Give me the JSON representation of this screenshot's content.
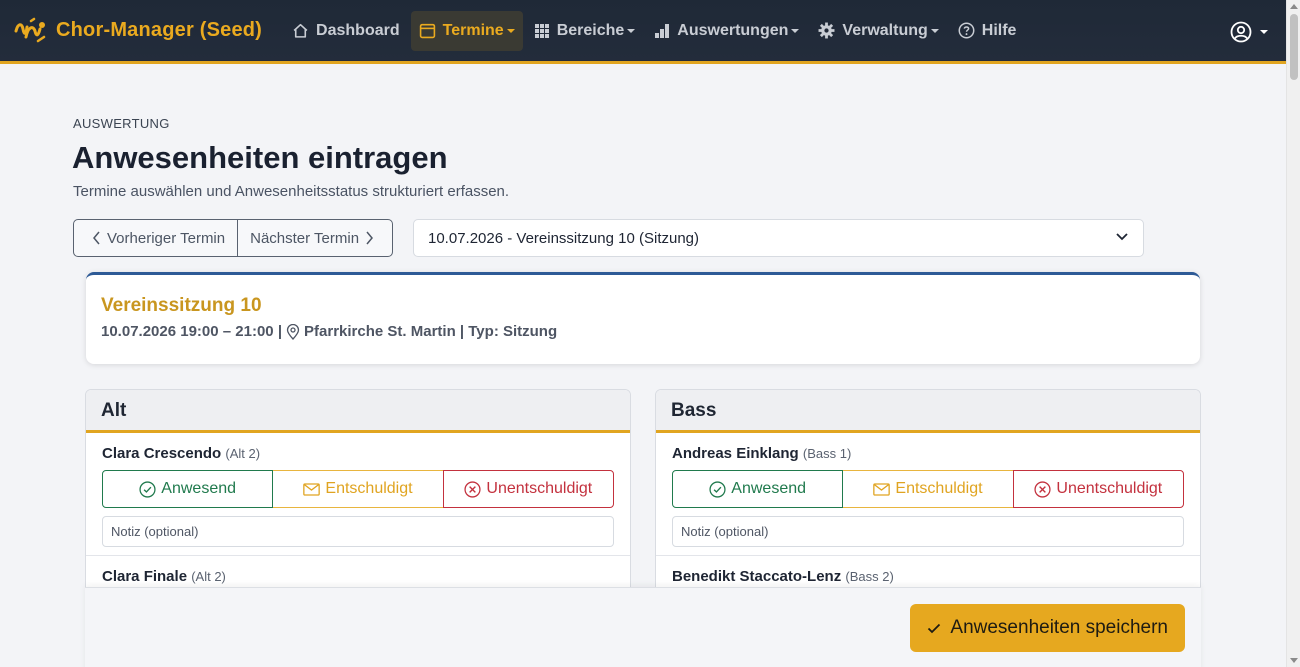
{
  "brand": {
    "name": "Chor-Manager (Seed)",
    "logo_icon": "choir-logo-icon",
    "accent": "#e1a520"
  },
  "nav": {
    "items": [
      {
        "label": "Dashboard",
        "icon": "home-icon",
        "active": false,
        "dropdown": false
      },
      {
        "label": "Termine",
        "icon": "calendar-icon",
        "active": true,
        "dropdown": true
      },
      {
        "label": "Bereiche",
        "icon": "grid-icon",
        "active": false,
        "dropdown": true
      },
      {
        "label": "Auswertungen",
        "icon": "bar-chart-icon",
        "active": false,
        "dropdown": true
      },
      {
        "label": "Verwaltung",
        "icon": "gear-icon",
        "active": false,
        "dropdown": true
      },
      {
        "label": "Hilfe",
        "icon": "help-icon",
        "active": false,
        "dropdown": false
      }
    ],
    "user_icon": "user-circle-icon"
  },
  "header": {
    "eyebrow": "AUSWERTUNG",
    "title": "Anwesenheiten eintragen",
    "subtitle": "Termine auswählen und Anwesenheitsstatus strukturiert erfassen."
  },
  "controls": {
    "prev_label": "Vorheriger Termin",
    "next_label": "Nächster Termin",
    "selected_event": "10.07.2026 - Vereinssitzung 10 (Sitzung)"
  },
  "event": {
    "title": "Vereinssitzung 10",
    "datetime": "10.07.2026 19:00 – 21:00 |",
    "location": "Pfarrkirche St. Martin | Typ: Sitzung",
    "border_color": "#2d5a96"
  },
  "status_labels": {
    "present": "Anwesend",
    "excused": "Entschuldigt",
    "unexcused": "Unentschuldigt",
    "note_placeholder": "Notiz (optional)"
  },
  "sections": [
    {
      "title": "Alt",
      "members": [
        {
          "name": "Clara Crescendo",
          "voice": "(Alt 2)"
        },
        {
          "name": "Clara Finale",
          "voice": "(Alt 2)"
        }
      ]
    },
    {
      "title": "Bass",
      "members": [
        {
          "name": "Andreas Einklang",
          "voice": "(Bass 1)"
        },
        {
          "name": "Benedikt Staccato-Lenz",
          "voice": "(Bass 2)"
        }
      ]
    }
  ],
  "footer": {
    "save_label": "Anwesenheiten speichern"
  }
}
